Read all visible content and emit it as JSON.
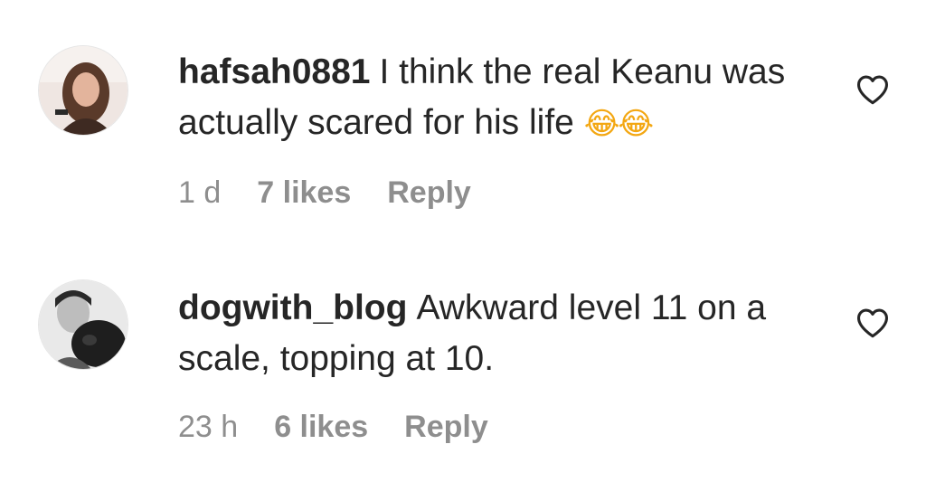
{
  "comments": [
    {
      "username": "hafsah0881",
      "text": "I think the real Keanu was actually scared for his life",
      "emoji": "😂😂",
      "time": "1 d",
      "likes": "7 likes",
      "reply": "Reply",
      "like_icon": "heart-outline-icon"
    },
    {
      "username": "dogwith_blog",
      "text": "Awkward level 11 on a scale, topping at 10.",
      "time": "23 h",
      "likes": "6 likes",
      "reply": "Reply",
      "like_icon": "heart-outline-icon"
    }
  ]
}
